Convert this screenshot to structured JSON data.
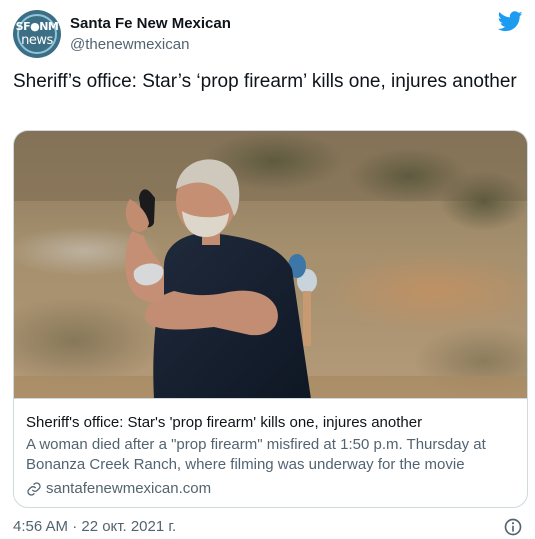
{
  "account": {
    "display_name": "Santa Fe New Mexican",
    "handle": "@thenewmexican",
    "avatar_line1": "SF●NM",
    "avatar_line2": "news"
  },
  "tweet": {
    "text": "Sheriff’s office: Star’s ‘prop firearm’ kills one, injures another"
  },
  "card": {
    "title": "Sheriff's office: Star's 'prop firearm' kills one, injures another",
    "description": "A woman died after a \"prop firearm\" misfired at 1:50 p.m. Thursday at Bonanza Creek Ranch, where filming was underway for the movie \"Rust\"...",
    "domain": "santafenewmexican.com"
  },
  "footer": {
    "timestamp": "4:56 AM · 22 окт. 2021 г."
  },
  "icons": {
    "brand": "twitter-bird-icon",
    "link": "link-icon",
    "info": "info-icon"
  },
  "colors": {
    "brand_blue": "#1d9bf0",
    "text_primary": "#0f1419",
    "text_secondary": "#536471",
    "border": "#cfd9de"
  }
}
